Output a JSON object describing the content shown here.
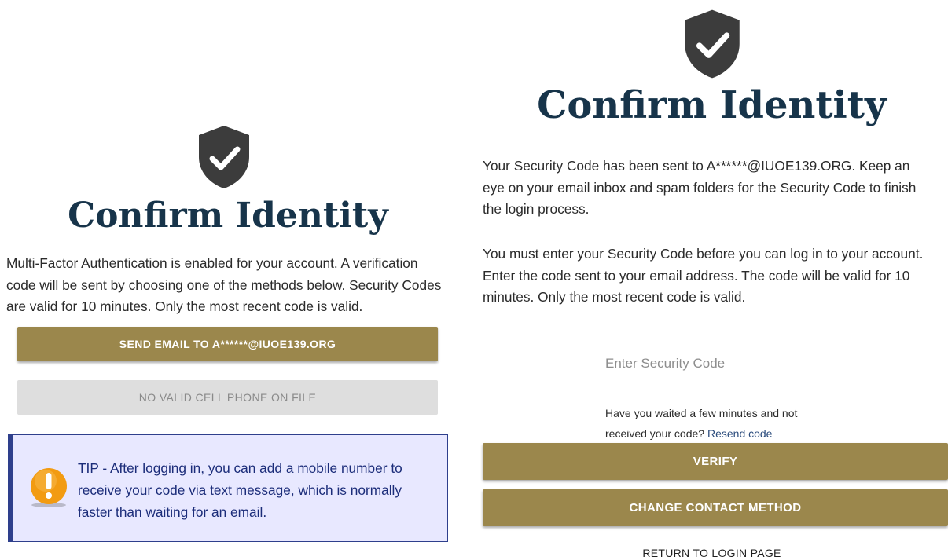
{
  "left": {
    "shield_icon": "shield-check-icon",
    "title": "Confirm Identity",
    "description_lines": [
      "Multi-Factor Authentication is enabled for your account. A verification",
      "code will be sent by choosing one of the methods below. Security Codes",
      "are valid for 10 minutes. Only the most recent code is valid."
    ],
    "send_email_label": "SEND EMAIL TO A******@IUOE139.ORG",
    "no_phone_label": "NO VALID CELL PHONE ON FILE",
    "tip": {
      "icon": "warning-exclamation-icon",
      "lines": [
        "TIP - After logging in, you can add a mobile number to",
        "receive your code via text message, which is normally",
        "faster than waiting for an email."
      ]
    }
  },
  "right": {
    "shield_icon": "shield-check-icon",
    "title": "Confirm Identity",
    "sent_lines": [
      "Your Security Code has been sent to A******@IUOE139.ORG. Keep an",
      "eye on your email inbox and spam folders for the Security Code to finish",
      "the login process."
    ],
    "enter_lines": [
      "You must enter your Security Code before you can log in to your account.",
      "Enter the code sent to your email address. The code will be valid for 10",
      "minutes. Only the most recent code is valid."
    ],
    "code_placeholder": "Enter Security Code",
    "code_value": "",
    "resend_text_line1": "Have you waited a few minutes and not",
    "resend_text_line2": "received your code?",
    "resend_link": "Resend code",
    "verify_label": "VERIFY",
    "change_contact_label": "CHANGE CONTACT METHOD",
    "return_label": "RETURN TO LOGIN PAGE"
  },
  "colors": {
    "accent_gold": "#9b874c",
    "title_navy": "#17344a",
    "shield_gray": "#3c3c3c",
    "tip_background": "#e8e8ff",
    "tip_border": "#2e3f8c",
    "tip_text": "#1c2d7a",
    "disabled_button": "#dedede",
    "warning_orange": "#f29b12"
  }
}
